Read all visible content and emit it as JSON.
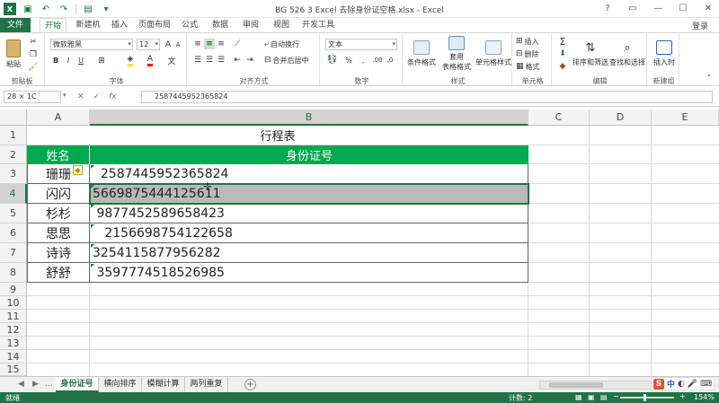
{
  "window": {
    "title": "BG 526 3 Excel 去除身份证空格.xlsx - Excel",
    "controls": [
      "?",
      "▭",
      "—",
      "☐",
      "✕"
    ]
  },
  "ribbon_tabs": {
    "file": "文件",
    "tabs": [
      "开始",
      "插入",
      "页面布局",
      "公式",
      "数据",
      "审阅",
      "视图",
      "开发工具"
    ],
    "extra_tab": "新建机",
    "active": "开始",
    "login": "登录"
  },
  "ribbon": {
    "clipboard": {
      "paste": "粘贴",
      "label": "剪贴板"
    },
    "font": {
      "name": "微软雅黑",
      "size": "12",
      "label": "字体",
      "bold": "B",
      "italic": "I",
      "underline": "U"
    },
    "alignment": {
      "wrap": "自动换行",
      "merge": "合并后居中",
      "label": "对齐方式"
    },
    "number": {
      "format": "文本",
      "percent": "%",
      "comma": ",",
      "label": "数字"
    },
    "styles": {
      "cond": "条件格式",
      "table1": "套用",
      "table2": "表格格式",
      "cell": "单元格样式",
      "label": "样式"
    },
    "cells": {
      "insert": "插入",
      "delete": "删除",
      "format": "格式",
      "label": "单元格"
    },
    "editing": {
      "sort": "排序和筛选",
      "find": "查找和选择",
      "label": "编辑"
    },
    "newgroup": {
      "insert_time": "插入时",
      "label": "新建组"
    }
  },
  "formula_bar": {
    "name_box": "28 × 1C",
    "cancel": "✕",
    "enter": "✓",
    "fx": "fx",
    "content": "2587445952365824"
  },
  "columns": [
    "A",
    "B",
    "C",
    "D",
    "E"
  ],
  "rows": [
    "1",
    "2",
    "3",
    "4",
    "5",
    "6",
    "7",
    "8",
    "9",
    "10",
    "11",
    "12",
    "13",
    "14",
    "15"
  ],
  "sheet": {
    "title": "行程表",
    "header_name": "姓名",
    "header_id": "身份证号",
    "data": [
      {
        "name": "珊珊",
        "id": "  2587445952365824"
      },
      {
        "name": "闪闪",
        "id": "5669875444125611"
      },
      {
        "name": "杉杉",
        "id": " 9877452589658423"
      },
      {
        "name": "思思",
        "id": "   2156698754122658"
      },
      {
        "name": "诗诗",
        "id": "3254115877956282"
      },
      {
        "name": "舒舒",
        "id": " 3597774518526985"
      }
    ]
  },
  "sheet_tabs": {
    "tabs": [
      "身份证号",
      "横向排序",
      "模糊计算",
      "两列重复"
    ],
    "active": "身份证号",
    "add": "+"
  },
  "status": {
    "mode": "就绪",
    "count": "计数: 2",
    "zoom": "154%",
    "zoom_fraction": 0.45
  },
  "ime": {
    "logo": "S",
    "lang": "中"
  },
  "colors": {
    "accent": "#217346",
    "header_fill": "#00a84f",
    "selected_row": "#b9b9b9"
  }
}
